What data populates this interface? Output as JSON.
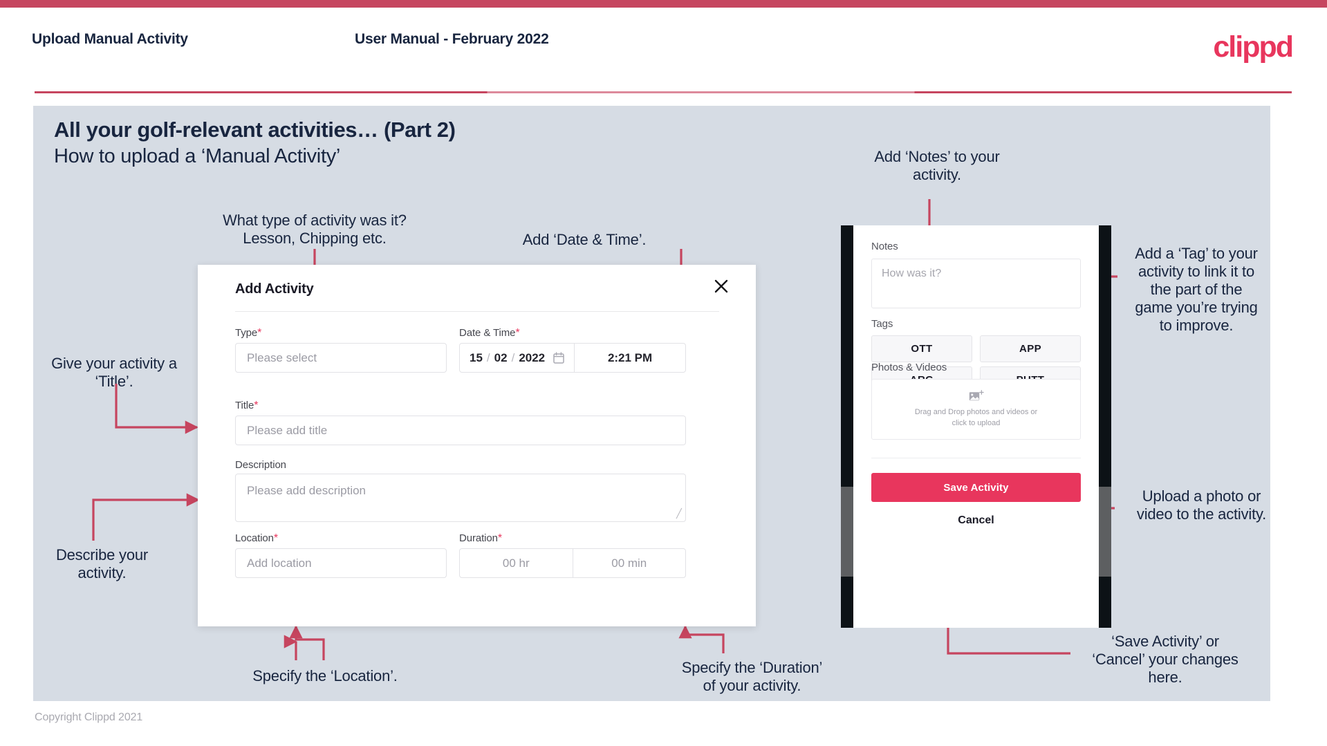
{
  "header": {
    "left_title": "Upload Manual Activity",
    "center_title": "User Manual - February 2022",
    "logo": "clippd"
  },
  "slide": {
    "title": "All your golf-relevant activities… (Part 2)",
    "subtitle": "How to upload a ‘Manual Activity’"
  },
  "annotations": {
    "type": "What type of activity was it?\nLesson, Chipping etc.",
    "datetime": "Add ‘Date & Time’.",
    "title": "Give your activity a\n‘Title’.",
    "description": "Describe your\nactivity.",
    "location": "Specify the ‘Location’.",
    "duration": "Specify the ‘Duration’\nof your activity.",
    "notes": "Add ‘Notes’ to your\nactivity.",
    "tags": "Add a ‘Tag’ to your\nactivity to link it to\nthe part of the\ngame you’re trying\nto improve.",
    "photos": "Upload a photo or\nvideo to the activity.",
    "save": "‘Save Activity’ or\n‘Cancel’ your changes\nhere."
  },
  "dialog": {
    "title": "Add Activity",
    "close_icon": "close-icon",
    "fields": {
      "type": {
        "label": "Type",
        "required": "*",
        "placeholder": "Please select"
      },
      "datetime": {
        "label": "Date & Time",
        "required": "*",
        "day": "15",
        "month": "02",
        "year": "2022",
        "sep": "/",
        "time": "2:21 PM",
        "calendar_icon": "calendar-icon"
      },
      "title": {
        "label": "Title",
        "required": "*",
        "placeholder": "Please add title"
      },
      "description": {
        "label": "Description",
        "placeholder": "Please add description"
      },
      "location": {
        "label": "Location",
        "required": "*",
        "placeholder": "Add location"
      },
      "duration": {
        "label": "Duration",
        "required": "*",
        "hours": "00 hr",
        "minutes": "00 min"
      }
    }
  },
  "phone": {
    "notes": {
      "label": "Notes",
      "placeholder": "How was it?"
    },
    "tags": {
      "label": "Tags",
      "items": [
        "OTT",
        "APP",
        "ARG",
        "PUTT"
      ]
    },
    "photos": {
      "label": "Photos & Videos",
      "icon": "add-image-icon",
      "drop_text_line1": "Drag and Drop photos and videos or",
      "drop_text_line2": "click to upload"
    },
    "save_label": "Save Activity",
    "cancel_label": "Cancel"
  },
  "footer": {
    "copyright": "Copyright Clippd 2021"
  },
  "colors": {
    "accent": "#e8365d",
    "bar": "#c6455f",
    "panel_bg": "#d6dce4",
    "ink": "#18253f",
    "connector": "#c6455f"
  }
}
